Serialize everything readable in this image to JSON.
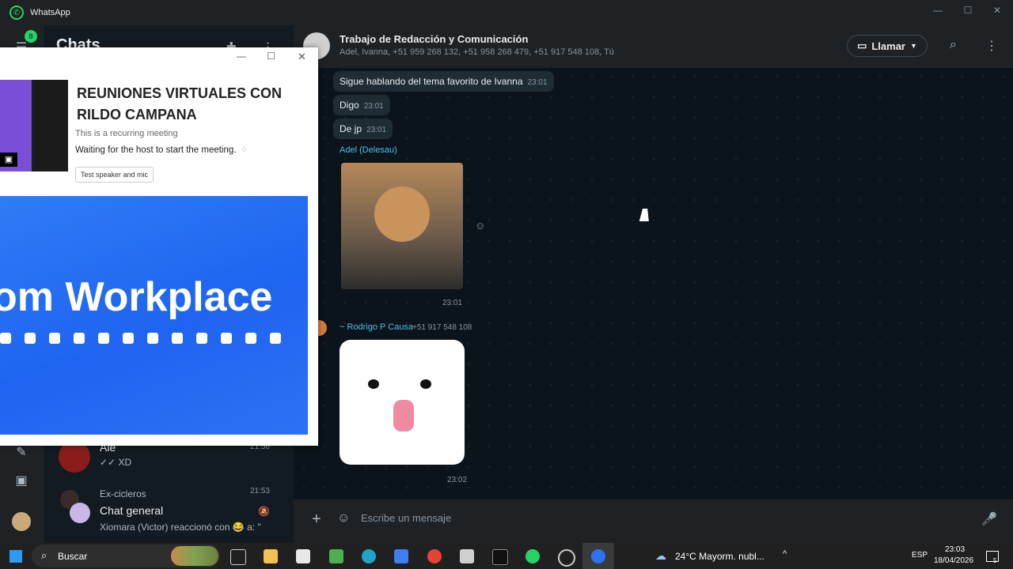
{
  "window": {
    "title": "WhatsApp"
  },
  "rail": {
    "badge": "8"
  },
  "chatlist": {
    "heading": "Chats",
    "rows": [
      {
        "name": "Ale",
        "time": "21:56",
        "preview": "✓✓ XD"
      },
      {
        "group": "Ex-cicleros",
        "name": "Chat general",
        "time": "21:53",
        "preview": "Xiomara (Victor) reaccionó con 😂 a: \""
      }
    ]
  },
  "conversation": {
    "title": "Trabajo de Redacción y Comunicación",
    "members": "Adel, Ivanna, +51 959 268 132, +51 958 268 479, +51 917 548 108, Tú",
    "call_label": "Llamar",
    "messages": [
      {
        "text": "Sigue hablando del tema favorito de Ivanna",
        "time": "23:01"
      },
      {
        "text": "Digo",
        "time": "23:01"
      },
      {
        "text": "De jp",
        "time": "23:01"
      },
      {
        "sender": "Adel (Delesau)",
        "sticker": "dog-sticker",
        "time": "23:01"
      },
      {
        "sender": "~ Rodrigo P Causa",
        "phone": "+51 917 548 108",
        "sticker": "cat-sticker",
        "time": "23:02"
      }
    ],
    "composer_placeholder": "Escribe un mensaje"
  },
  "zoom": {
    "title": "REUNIONES VIRTUALES CON RILDO CAMPANA",
    "recurring": "This is a recurring meeting",
    "waiting": "Waiting for the host to start the meeting.",
    "test_button": "Test speaker and mic",
    "banner_text": "om Workplace"
  },
  "taskbar": {
    "search": "Buscar",
    "weather": "24°C  Mayorm. nubl...",
    "lang": "ESP",
    "time": "23:03",
    "date": "18/04/2026",
    "notifications": "5"
  },
  "colors": {
    "accent": "#25d366",
    "link": "#53bdeb",
    "zoom_blue": "#2d72f5"
  }
}
